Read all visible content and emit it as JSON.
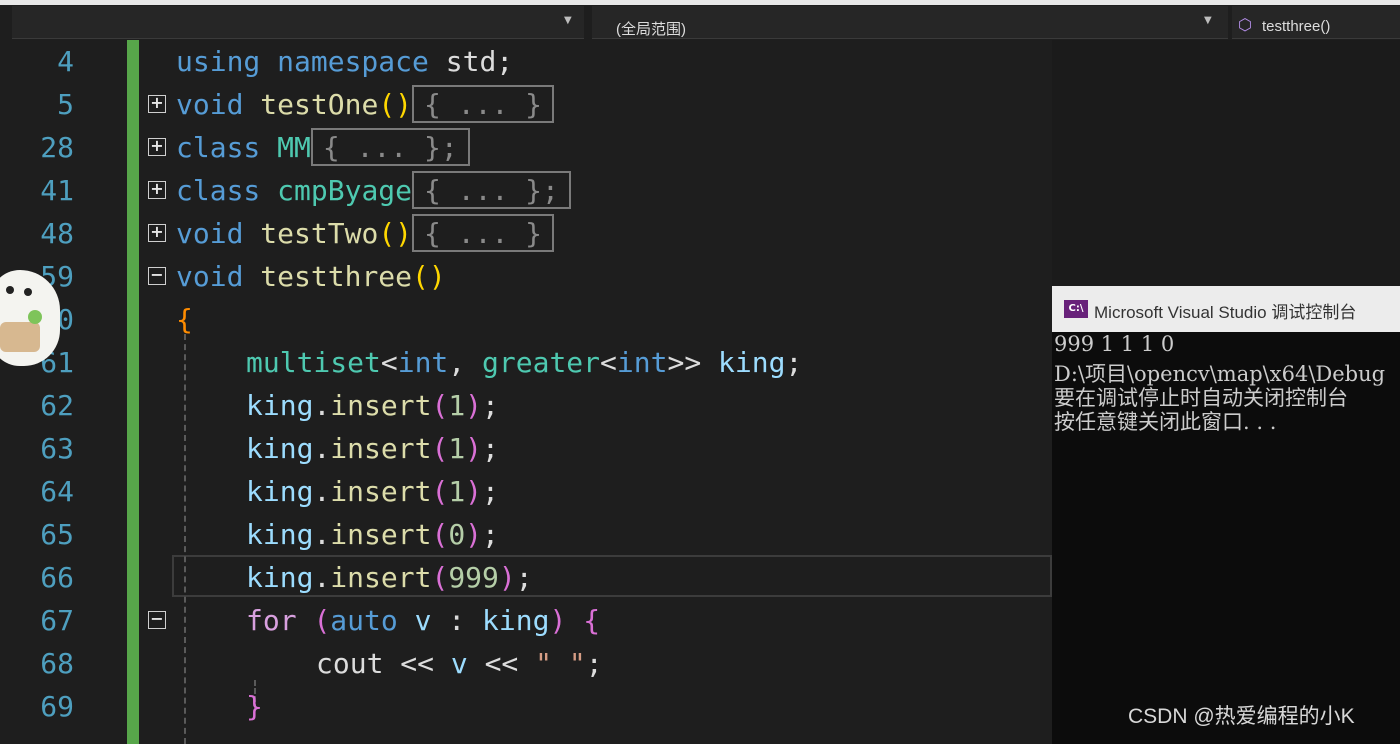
{
  "toolbar": {
    "scope_label": "(全局范围)",
    "member_label": "testthree()",
    "member_icon": "cube-icon"
  },
  "editor": {
    "lines": [
      {
        "num": "4",
        "text": "using namespace std;"
      },
      {
        "num": "5",
        "text": "void testOne()",
        "collapsed": "{ ... }"
      },
      {
        "num": "28",
        "text": "class MM",
        "collapsed": "{ ... };"
      },
      {
        "num": "41",
        "text": "class cmpByage",
        "collapsed": "{ ... };"
      },
      {
        "num": "48",
        "text": "void testTwo()",
        "collapsed": "{ ... }"
      },
      {
        "num": "59",
        "text": "void testthree()"
      },
      {
        "num": "60",
        "text": "{"
      },
      {
        "num": "61",
        "text": "multiset<int, greater<int>> king;"
      },
      {
        "num": "62",
        "text": "king.insert(1);"
      },
      {
        "num": "63",
        "text": "king.insert(1);"
      },
      {
        "num": "64",
        "text": "king.insert(1);"
      },
      {
        "num": "65",
        "text": "king.insert(0);"
      },
      {
        "num": "66",
        "text": "king.insert(999);"
      },
      {
        "num": "67",
        "text": "for (auto v : king) {"
      },
      {
        "num": "68",
        "text": "cout << v << \" \";"
      },
      {
        "num": "69",
        "text": "}"
      }
    ]
  },
  "console": {
    "title": "Microsoft Visual Studio 调试控制台",
    "lines": [
      "999 1 1 1 0",
      "D:\\项目\\opencv\\map\\x64\\Debug",
      "要在调试停止时自动关闭控制台",
      "按任意键关闭此窗口. . ."
    ]
  },
  "watermark": "CSDN @热爱编程的小K",
  "colors": {
    "keyword": "#569cd6",
    "function": "#dcdcaa",
    "type": "#4ec9b0",
    "variable": "#9cdcfe",
    "line_number": "#4e9fbf",
    "change_bar": "#57a64a"
  }
}
